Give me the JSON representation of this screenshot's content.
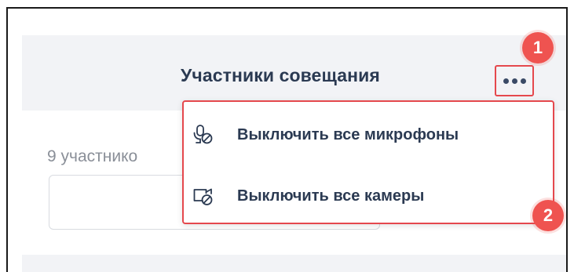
{
  "panel": {
    "title": "Участники совещания",
    "participants_count": "9 участнико"
  },
  "menu": {
    "items": [
      {
        "label": "Выключить все микрофоны",
        "icon": "microphone-off-icon"
      },
      {
        "label": "Выключить все камеры",
        "icon": "camera-off-icon"
      }
    ]
  },
  "annotations": {
    "badge_1": "1",
    "badge_2": "2"
  },
  "colors": {
    "accent_red": "#e5484d",
    "badge_red": "#ef5350",
    "text_dark": "#2b3a52",
    "header_bg": "#f2f3f6"
  }
}
